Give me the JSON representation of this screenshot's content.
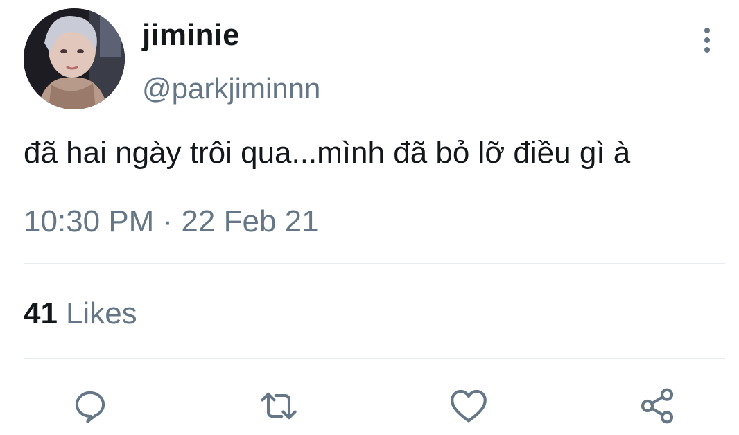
{
  "user": {
    "display_name": "jiminie",
    "handle": "@parkjiminnn"
  },
  "tweet": {
    "text": "đã hai ngày trôi qua...mình đã bỏ lỡ điều gì à",
    "timestamp": "10:30 PM · 22 Feb 21"
  },
  "stats": {
    "likes_count": "41",
    "likes_label": "Likes"
  },
  "actions": [
    {
      "icon": "reply-icon"
    },
    {
      "icon": "retweet-icon"
    },
    {
      "icon": "like-heart-icon"
    },
    {
      "icon": "share-icon"
    }
  ],
  "colors": {
    "text_primary": "#14171a",
    "text_secondary": "#657786",
    "divider": "#e6ecf0"
  }
}
